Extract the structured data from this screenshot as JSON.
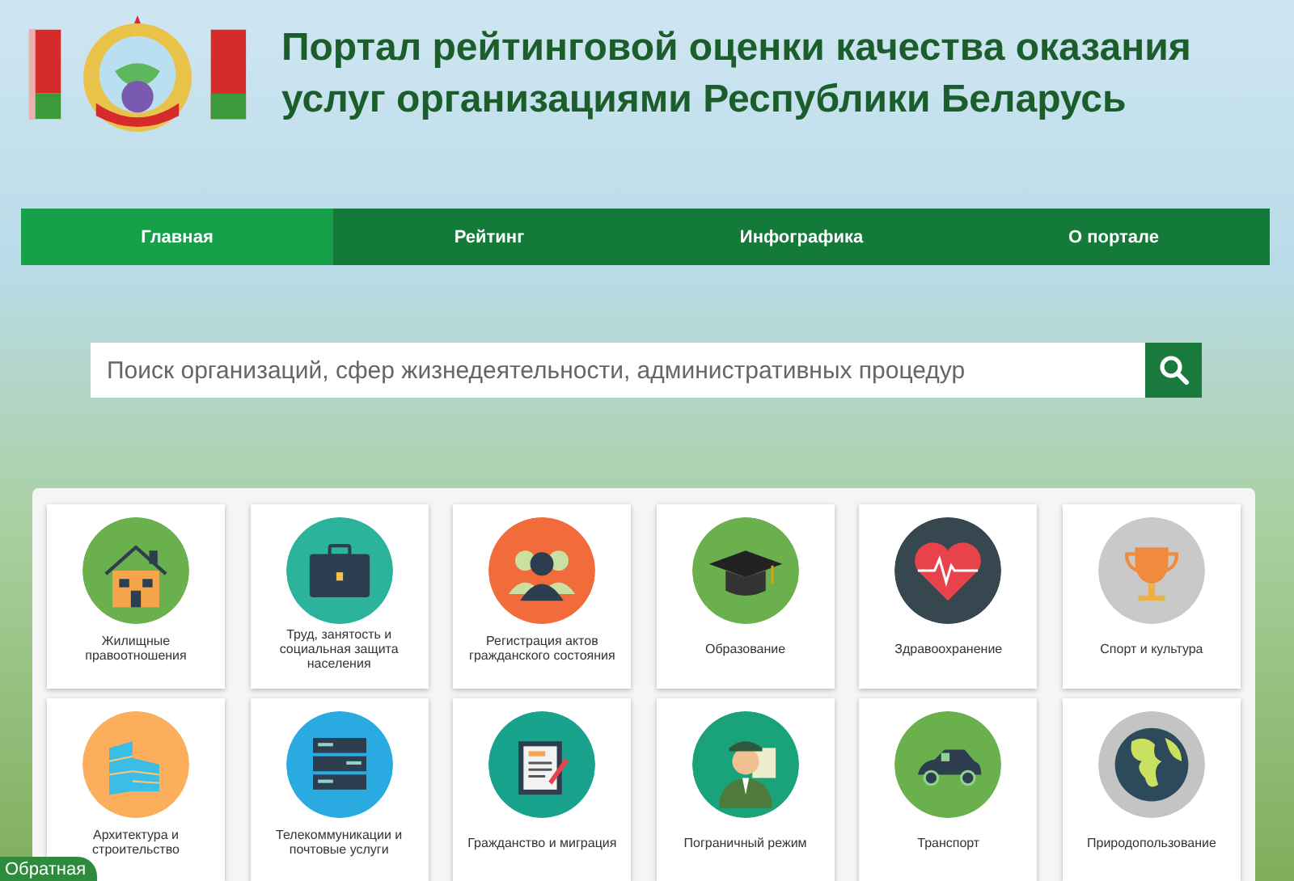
{
  "header": {
    "title_lines": [
      "Портал рейтинговой оценки качества оказания",
      "услуг организациями Республики Беларусь"
    ]
  },
  "nav": [
    {
      "label": "Главная",
      "selected": true
    },
    {
      "label": "Рейтинг",
      "selected": false
    },
    {
      "label": "Инфографика",
      "selected": false
    },
    {
      "label": "О портале",
      "selected": false
    }
  ],
  "search": {
    "placeholder": "Поиск организаций, сфер жизнедеятельности, административных процедур"
  },
  "categories": [
    {
      "label": "Жилищные правоотношения",
      "color": "#6ab04c"
    },
    {
      "label": "Труд, занятость и социальная защита населения",
      "color": "#2bb39b"
    },
    {
      "label": "Регистрация актов гражданского состояния",
      "color": "#f26b3a"
    },
    {
      "label": "Образование",
      "color": "#6ab04c"
    },
    {
      "label": "Здравоохранение",
      "color": "#37474f"
    },
    {
      "label": "Спорт и культура",
      "color": "#c9c9c9"
    },
    {
      "label": "Архитектура и строительство",
      "color": "#fbae5c"
    },
    {
      "label": "Телекоммуникации и почтовые услуги",
      "color": "#29abe2"
    },
    {
      "label": "Гражданство и миграция",
      "color": "#1aa38c"
    },
    {
      "label": "Пограничный режим",
      "color": "#1aa37a"
    },
    {
      "label": "Транспорт",
      "color": "#6ab04c"
    },
    {
      "label": "Природопользование",
      "color": "#c4c4c4"
    }
  ],
  "feedback": {
    "label": "Обратная"
  }
}
